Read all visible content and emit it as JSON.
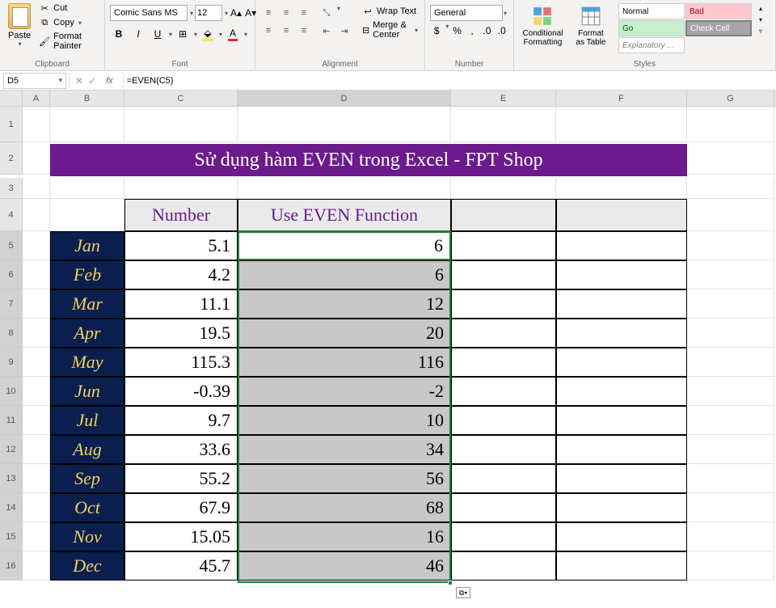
{
  "ribbon": {
    "clipboard": {
      "group_label": "Clipboard",
      "paste_label": "Paste",
      "cut_label": "Cut",
      "copy_label": "Copy",
      "fp_label": "Format Painter"
    },
    "font": {
      "group_label": "Font",
      "font_name": "Comic Sans MS",
      "font_size": "12",
      "bold": "B",
      "italic": "I",
      "underline": "U"
    },
    "alignment": {
      "group_label": "Alignment",
      "wrap_label": "Wrap Text",
      "merge_label": "Merge & Center"
    },
    "number": {
      "group_label": "Number",
      "format": "General"
    },
    "styles": {
      "group_label": "Styles",
      "cond_fmt": "Conditional Formatting",
      "fmt_table": "Format as Table",
      "normal": "Normal",
      "bad": "Bad",
      "good": "Go",
      "check": "Check Cell",
      "expl": "Explanatory ..."
    }
  },
  "formula_bar": {
    "cell_ref": "D5",
    "formula": "=EVEN(C5)"
  },
  "columns": [
    "A",
    "B",
    "C",
    "D",
    "E",
    "F",
    "G"
  ],
  "sheet": {
    "title": "Sử dụng hàm EVEN trong Excel - FPT Shop",
    "headers": {
      "number": "Number",
      "use_even": "Use EVEN Function"
    },
    "rows": [
      {
        "month": "Jan",
        "number": "5.1",
        "result": "6"
      },
      {
        "month": "Feb",
        "number": "4.2",
        "result": "6"
      },
      {
        "month": "Mar",
        "number": "11.1",
        "result": "12"
      },
      {
        "month": "Apr",
        "number": "19.5",
        "result": "20"
      },
      {
        "month": "May",
        "number": "115.3",
        "result": "116"
      },
      {
        "month": "Jun",
        "number": "-0.39",
        "result": "-2"
      },
      {
        "month": "Jul",
        "number": "9.7",
        "result": "10"
      },
      {
        "month": "Aug",
        "number": "33.6",
        "result": "34"
      },
      {
        "month": "Sep",
        "number": "55.2",
        "result": "56"
      },
      {
        "month": "Oct",
        "number": "67.9",
        "result": "68"
      },
      {
        "month": "Nov",
        "number": "15.05",
        "result": "16"
      },
      {
        "month": "Dec",
        "number": "45.7",
        "result": "46"
      }
    ]
  }
}
